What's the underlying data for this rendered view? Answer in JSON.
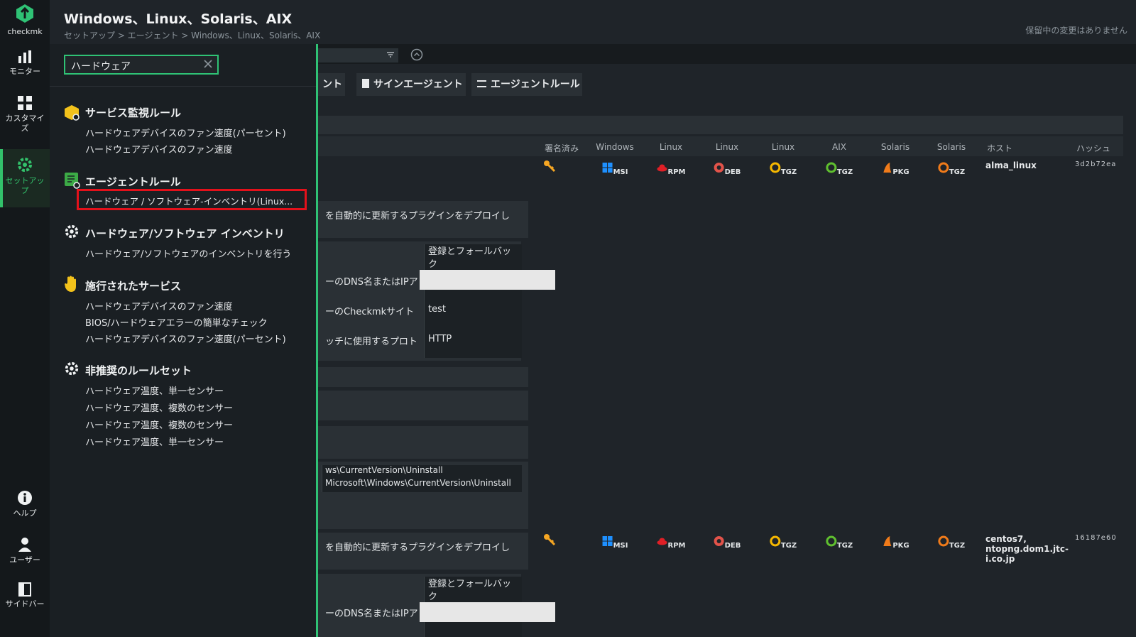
{
  "nav": {
    "logo_label": "checkmk",
    "items": [
      {
        "label": "モニター"
      },
      {
        "label": "カスタマイズ"
      },
      {
        "label": "セットアップ"
      },
      {
        "label": "ヘルプ"
      },
      {
        "label": "ユーザー"
      },
      {
        "label": "サイドバー"
      }
    ]
  },
  "header": {
    "title": "Windows、Linux、Solaris、AIX",
    "breadcrumb": "セットアップ > エージェント > Windows、Linux、Solaris、AIX",
    "pending": "保留中の変更はありません"
  },
  "toolbar": {
    "partial_button": "ント",
    "sign_agents": "サインエージェント",
    "agent_rules": "エージェントルール"
  },
  "table": {
    "headers": [
      "署名済み",
      "Windows",
      "Linux",
      "Linux",
      "Linux",
      "AIX",
      "Solaris",
      "Solaris",
      "ホスト",
      "ハッシュ"
    ],
    "packages": [
      "MSI",
      "RPM",
      "DEB",
      "TGZ",
      "TGZ",
      "PKG",
      "TGZ"
    ],
    "rows": [
      {
        "host": "alma_linux",
        "hash": "3d2b72ea"
      },
      {
        "host": "centos7,\nntopng.dom1.jtc-\ni.co.jp",
        "hash": "16187e60"
      }
    ],
    "plugin_text": "を自動的に更新するプラグインをデプロイし",
    "register_fallback": "登録とフォールバック",
    "dns_label": "ーのDNS名またはIPア",
    "site_label": "ーのCheckmkサイト",
    "site_value": "test",
    "protocol_label": "ッチに使用するプロト",
    "protocol_value": "HTTP",
    "registry_line1": "ws\\CurrentVersion\\Uninstall",
    "registry_line2": "Microsoft\\Windows\\CurrentVersion\\Uninstall"
  },
  "search": {
    "value": "ハードウェア",
    "groups": [
      {
        "title": "サービス監視ルール",
        "results": [
          "ハードウェアデバイスのファン速度(パーセント)",
          "ハードウェアデバイスのファン速度"
        ]
      },
      {
        "title": "エージェントルール",
        "results": [
          "ハードウェア / ソフトウェア-インベントリ(Linux..."
        ]
      },
      {
        "title": "ハードウェア/ソフトウェア インベントリ",
        "results": [
          "ハードウェア/ソフトウェアのインベントリを行う"
        ]
      },
      {
        "title": "施行されたサービス",
        "results": [
          "ハードウェアデバイスのファン速度",
          "BIOS/ハードウェアエラーの簡単なチェック",
          "ハードウェアデバイスのファン速度(パーセント)"
        ]
      },
      {
        "title": "非推奨のルールセット",
        "results": [
          "ハードウェア温度、単一センサー",
          "ハードウェア温度、複数のセンサー",
          "ハードウェア温度、複数のセンサー",
          "ハードウェア温度、単一センサー"
        ]
      }
    ]
  },
  "colors": {
    "accent": "#2fc275",
    "highlight": "#e3111b",
    "background": "#1f2429"
  }
}
